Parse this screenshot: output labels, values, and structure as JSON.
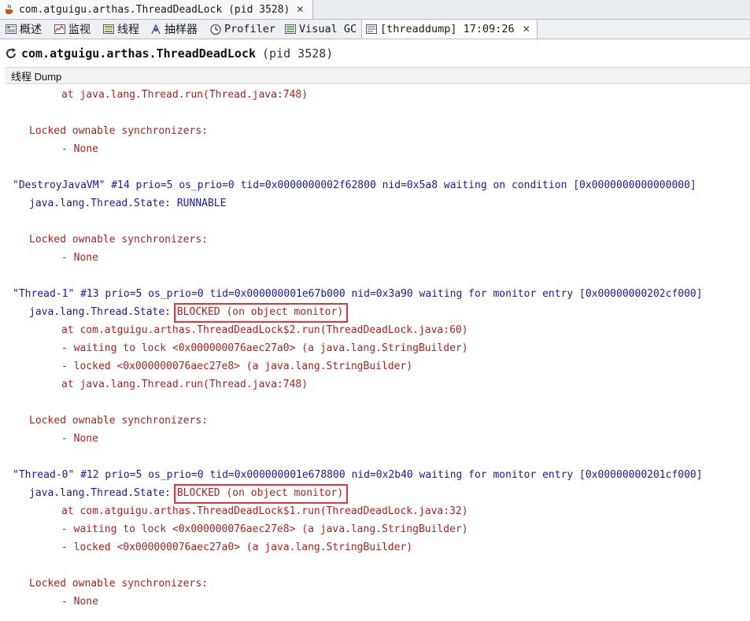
{
  "window": {
    "doc_tab": {
      "label": "com.atguigu.arthas.ThreadDeadLock (pid 3528)",
      "icon": "java-cup-icon",
      "close": "✕"
    }
  },
  "view_tabs": [
    {
      "label": "概述",
      "icon": "overview-icon"
    },
    {
      "label": "监视",
      "icon": "monitor-icon"
    },
    {
      "label": "线程",
      "icon": "threads-icon"
    },
    {
      "label": "抽样器",
      "icon": "sampler-icon"
    },
    {
      "label": "Profiler",
      "icon": "profiler-icon"
    },
    {
      "label": "Visual GC",
      "icon": "visual-gc-icon"
    },
    {
      "label": "[threaddump] 17:09:26",
      "icon": "threaddump-icon",
      "close": "✕",
      "active": true
    }
  ],
  "header": {
    "app": "com.atguigu.arthas.ThreadDeadLock",
    "pid": "(pid 3528)"
  },
  "section": {
    "title": "线程 Dump"
  },
  "dump_lines": [
    "\tat java.lang.Thread.run(Thread.java:748)",
    "",
    "   Locked ownable synchronizers:",
    "\t- None",
    "",
    "\"DestroyJavaVM\" #14 prio=5 os_prio=0 tid=0x0000000002f62800 nid=0x5a8 waiting on condition [0x0000000000000000]",
    "   java.lang.Thread.State: RUNNABLE",
    "",
    "   Locked ownable synchronizers:",
    "\t- None",
    "",
    "\"Thread-1\" #13 prio=5 os_prio=0 tid=0x000000001e67b000 nid=0x3a90 waiting for monitor entry [0x00000000202cf000]",
    "   java.lang.Thread.State: BLOCKED (on object monitor)",
    "\tat com.atguigu.arthas.ThreadDeadLock$2.run(ThreadDeadLock.java:60)",
    "\t- waiting to lock <0x000000076aec27a0> (a java.lang.StringBuilder)",
    "\t- locked <0x000000076aec27e8> (a java.lang.StringBuilder)",
    "\tat java.lang.Thread.run(Thread.java:748)",
    "",
    "   Locked ownable synchronizers:",
    "\t- None",
    "",
    "\"Thread-0\" #12 prio=5 os_prio=0 tid=0x000000001e678800 nid=0x2b40 waiting for monitor entry [0x00000000201cf000]",
    "   java.lang.Thread.State: BLOCKED (on object monitor)",
    "\tat com.atguigu.arthas.ThreadDeadLock$1.run(ThreadDeadLock.java:32)",
    "\t- waiting to lock <0x000000076aec27e8> (a java.lang.StringBuilder)",
    "\t- locked <0x000000076aec27a0> (a java.lang.StringBuilder)",
    "",
    "   Locked ownable synchronizers:",
    "\t- None"
  ],
  "colors": {
    "thread_header": "#1a1aa6",
    "body": "#b22222",
    "highlight_box": "#e8333c"
  }
}
